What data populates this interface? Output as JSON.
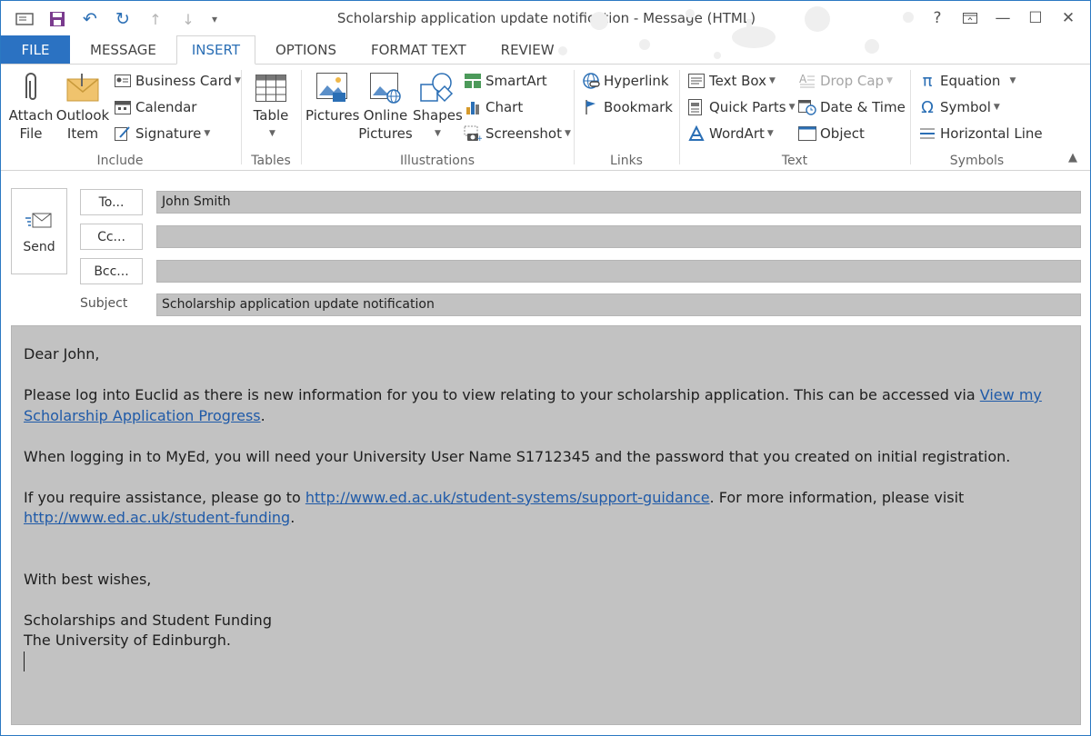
{
  "window": {
    "title": "Scholarship application update notification - Message (HTML)",
    "help": "?",
    "accent": "#2b72c2"
  },
  "tabs": [
    "FILE",
    "MESSAGE",
    "INSERT",
    "OPTIONS",
    "FORMAT TEXT",
    "REVIEW"
  ],
  "active_tab": "INSERT",
  "ribbon": {
    "include": {
      "label": "Include",
      "attach_file": [
        "Attach",
        "File"
      ],
      "outlook_item": [
        "Outlook",
        "Item"
      ],
      "business_card": "Business Card",
      "calendar": "Calendar",
      "signature": "Signature"
    },
    "tables": {
      "label": "Tables",
      "table": "Table"
    },
    "illustrations": {
      "label": "Illustrations",
      "pictures": "Pictures",
      "online_pictures": [
        "Online",
        "Pictures"
      ],
      "shapes": "Shapes",
      "smartart": "SmartArt",
      "chart": "Chart",
      "screenshot": "Screenshot"
    },
    "links": {
      "label": "Links",
      "hyperlink": "Hyperlink",
      "bookmark": "Bookmark"
    },
    "text": {
      "label": "Text",
      "text_box": "Text Box",
      "quick_parts": "Quick Parts",
      "wordart": "WordArt",
      "drop_cap": "Drop Cap",
      "date_time": "Date & Time",
      "object": "Object"
    },
    "symbols": {
      "label": "Symbols",
      "equation": "Equation",
      "symbol": "Symbol",
      "horizontal_line": "Horizontal Line"
    }
  },
  "compose": {
    "send": "Send",
    "to_button": "To...",
    "cc_button": "Cc...",
    "bcc_button": "Bcc...",
    "to_value": "John Smith",
    "cc_value": "",
    "bcc_value": "",
    "subject_label": "Subject",
    "subject_value": "Scholarship application update notification"
  },
  "body": {
    "greeting": "Dear John,",
    "p1_text": "Please log into Euclid as there is new information for you to view relating to your scholarship application. This can be accessed via ",
    "p1_link1": "View my",
    "p1_link2": "Scholarship Application Progress",
    "p1_end": ".",
    "p2": "When logging in to MyEd, you will need your University User Name S1712345 and the password that you created on initial registration.",
    "p3_text": "If you require assistance, please go to ",
    "p3_link": "http://www.ed.ac.uk/student-systems/support-guidance",
    "p3_mid": ". For more information, please visit",
    "p3_link2": "http://www.ed.ac.uk/student-funding",
    "p3_end": ".",
    "closing": "With best wishes,",
    "sig1": "Scholarships and Student Funding",
    "sig2": "The University of Edinburgh."
  }
}
